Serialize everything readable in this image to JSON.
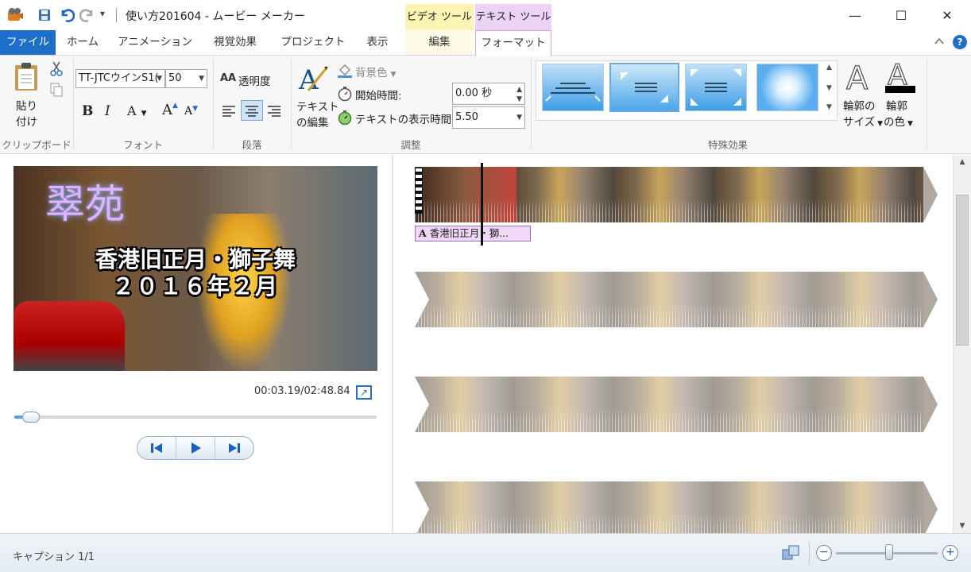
{
  "window": {
    "title": "使い方201604 - ムービー メーカー",
    "context_tabs": {
      "video_tools": "ビデオ ツール",
      "text_tools": "テキスト ツール"
    },
    "controls": {
      "minimize": "—",
      "maximize": "☐",
      "close": "✕"
    }
  },
  "quick_access": {
    "menu_arrow": "▾"
  },
  "tabs": {
    "file": "ファイル",
    "home": "ホーム",
    "animation": "アニメーション",
    "visual_effects": "視覚効果",
    "project": "プロジェクト",
    "view": "表示",
    "edit": "編集",
    "format": "フォーマット"
  },
  "ribbon": {
    "clipboard": {
      "paste_line1": "貼り",
      "paste_line2": "付け",
      "group": "クリップボード"
    },
    "font": {
      "family": "TT-JTCウインS1(",
      "size": "50",
      "bold": "B",
      "italic": "I",
      "color": "A",
      "grow": "A",
      "shrink": "A",
      "group": "フォント"
    },
    "paragraph": {
      "transparency": "透明度",
      "group": "段落"
    },
    "adjust": {
      "edit_text_line1": "テキスト",
      "edit_text_line2": "の編集",
      "background": "背景色",
      "start_time_label": "開始時間:",
      "start_time_value": "0.00 秒",
      "duration_label": "テキストの表示時間:",
      "duration_value": "5.50",
      "group": "調整"
    },
    "effects": {
      "outline_size_line1": "輪郭の",
      "outline_size_line2": "サイズ",
      "outline_color_line1": "輪郭",
      "outline_color_line2": "の色",
      "group": "特殊効果"
    }
  },
  "preview": {
    "neon_sign": "翠苑",
    "caption_line1": "香港旧正月・獅子舞",
    "caption_line2": "２０１６年２月",
    "timecode": "00:03.19/02:48.84",
    "seek_progress": 0.035
  },
  "storyboard": {
    "caption_clip": "香港旧正月・獅...",
    "strip_count": 4
  },
  "status": {
    "caption_count": "キャプション 1/1"
  },
  "zoom": {
    "level": 0.52
  },
  "colors": {
    "file_tab": "#1e6fc9",
    "video_tools": "#fdf4b3",
    "text_tools": "#ecd2f5",
    "accent": "#2b6fc2"
  }
}
